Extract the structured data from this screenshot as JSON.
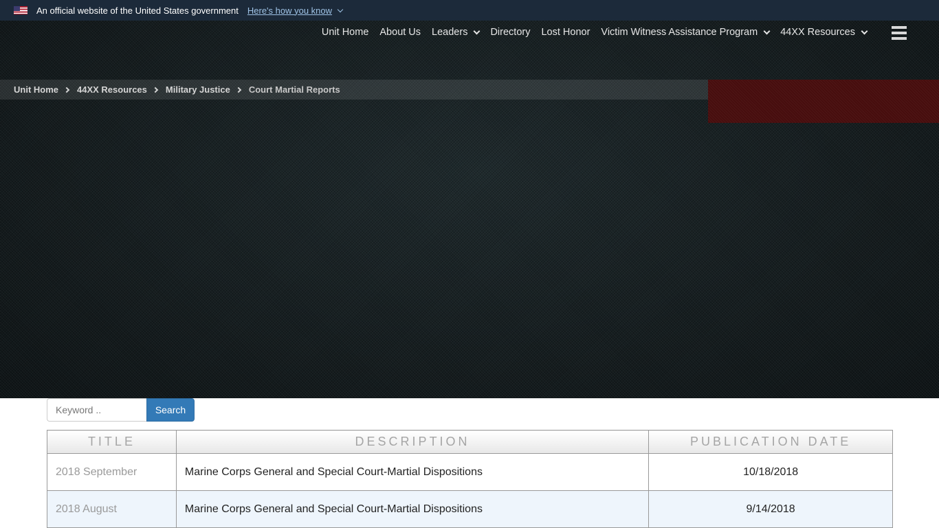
{
  "gov_banner": {
    "flag_icon": "us-flag-icon",
    "text": "An official website of the United States government",
    "link": "Here's how you know"
  },
  "nav": {
    "items": [
      {
        "label": "Unit Home",
        "dropdown": false
      },
      {
        "label": "About Us",
        "dropdown": false
      },
      {
        "label": "Leaders",
        "dropdown": true
      },
      {
        "label": "Directory",
        "dropdown": false
      },
      {
        "label": "Lost Honor",
        "dropdown": false
      },
      {
        "label": "Victim Witness Assistance Program",
        "dropdown": true
      },
      {
        "label": "44XX Resources",
        "dropdown": true
      }
    ],
    "menu_icon": "hamburger-menu-icon"
  },
  "breadcrumb": [
    {
      "label": "Unit Home"
    },
    {
      "label": "44XX Resources"
    },
    {
      "label": "Military Justice"
    },
    {
      "label": "Court Martial Reports"
    }
  ],
  "search": {
    "placeholder": "Keyword ..",
    "value": "",
    "button_label": "Search"
  },
  "table": {
    "headers": [
      "TITLE",
      "DESCRIPTION",
      "PUBLICATION DATE"
    ],
    "rows": [
      {
        "title": "2018 September",
        "description": "Marine Corps General and Special Court-Martial Dispositions",
        "date": "10/18/2018"
      },
      {
        "title": "2018 August",
        "description": "Marine Corps General and Special Court-Martial Dispositions",
        "date": "9/14/2018"
      }
    ]
  },
  "colors": {
    "banner_bg": "#1c2a3a",
    "link": "#9fc3e6",
    "search_button": "#337ab7",
    "accent_red": "#4a0d0d",
    "alt_row": "#eef5fc"
  }
}
